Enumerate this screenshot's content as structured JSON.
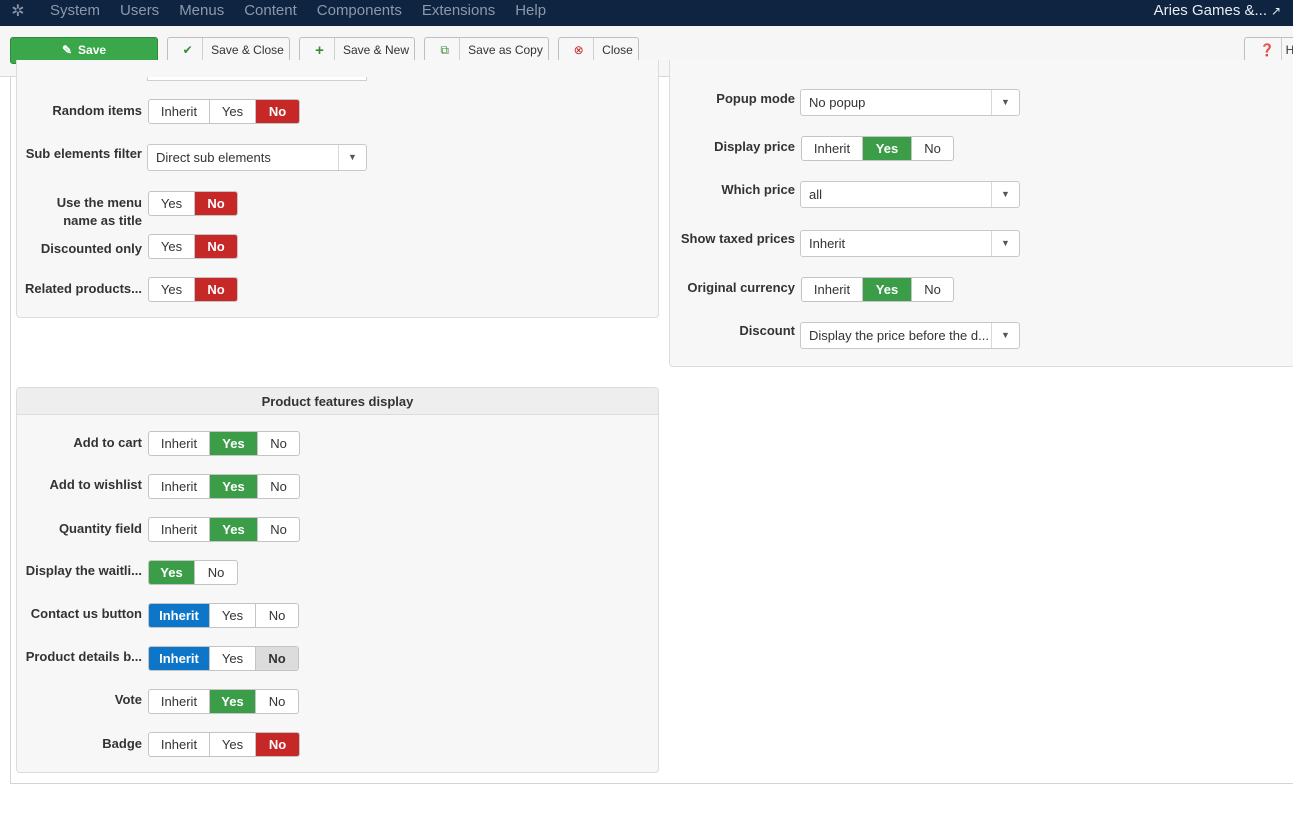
{
  "navbar": {
    "menu": [
      "System",
      "Users",
      "Menus",
      "Content",
      "Components",
      "Extensions",
      "Help"
    ],
    "site_name": "Aries Games &..."
  },
  "toolbar": {
    "save": "Save",
    "save_close": "Save & Close",
    "save_new": "Save & New",
    "save_copy": "Save as Copy",
    "close": "Close",
    "help": "H"
  },
  "left_top": {
    "random_items": {
      "label": "Random items",
      "options": [
        "Inherit",
        "Yes",
        "No"
      ],
      "selected": "No"
    },
    "sub_elements_filter": {
      "label": "Sub elements filter",
      "value": "Direct sub elements"
    },
    "menu_name_title": {
      "label_1": "Use the menu",
      "label_2": "name as title",
      "options": [
        "Yes",
        "No"
      ],
      "selected": "No"
    },
    "discounted_only": {
      "label": "Discounted only",
      "options": [
        "Yes",
        "No"
      ],
      "selected": "No"
    },
    "related_products": {
      "label": "Related products...",
      "options": [
        "Yes",
        "No"
      ],
      "selected": "No"
    }
  },
  "right_top": {
    "popup_mode": {
      "label": "Popup mode",
      "value": "No popup"
    },
    "display_price": {
      "label": "Display price",
      "options": [
        "Inherit",
        "Yes",
        "No"
      ],
      "selected": "Yes"
    },
    "which_price": {
      "label": "Which price",
      "value": "all"
    },
    "show_taxed": {
      "label": "Show taxed prices",
      "value": "Inherit"
    },
    "original_currency": {
      "label": "Original currency",
      "options": [
        "Inherit",
        "Yes",
        "No"
      ],
      "selected": "Yes"
    },
    "discount": {
      "label": "Discount",
      "value": "Display the price before the d..."
    }
  },
  "features": {
    "title": "Product features display",
    "add_to_cart": {
      "label": "Add to cart",
      "options": [
        "Inherit",
        "Yes",
        "No"
      ],
      "selected": "Yes"
    },
    "add_to_wishlist": {
      "label": "Add to wishlist",
      "options": [
        "Inherit",
        "Yes",
        "No"
      ],
      "selected": "Yes"
    },
    "quantity_field": {
      "label": "Quantity field",
      "options": [
        "Inherit",
        "Yes",
        "No"
      ],
      "selected": "Yes"
    },
    "waitlist": {
      "label": "Display the waitli...",
      "options": [
        "Yes",
        "No"
      ],
      "selected": "Yes"
    },
    "contact_us": {
      "label": "Contact us button",
      "options": [
        "Inherit",
        "Yes",
        "No"
      ],
      "selected": "Inherit"
    },
    "product_details": {
      "label": "Product details b...",
      "options": [
        "Inherit",
        "Yes",
        "No"
      ],
      "selected": "Inherit"
    },
    "vote": {
      "label": "Vote",
      "options": [
        "Inherit",
        "Yes",
        "No"
      ],
      "selected": "Yes"
    },
    "badge": {
      "label": "Badge",
      "options": [
        "Inherit",
        "Yes",
        "No"
      ],
      "selected": "No"
    }
  }
}
